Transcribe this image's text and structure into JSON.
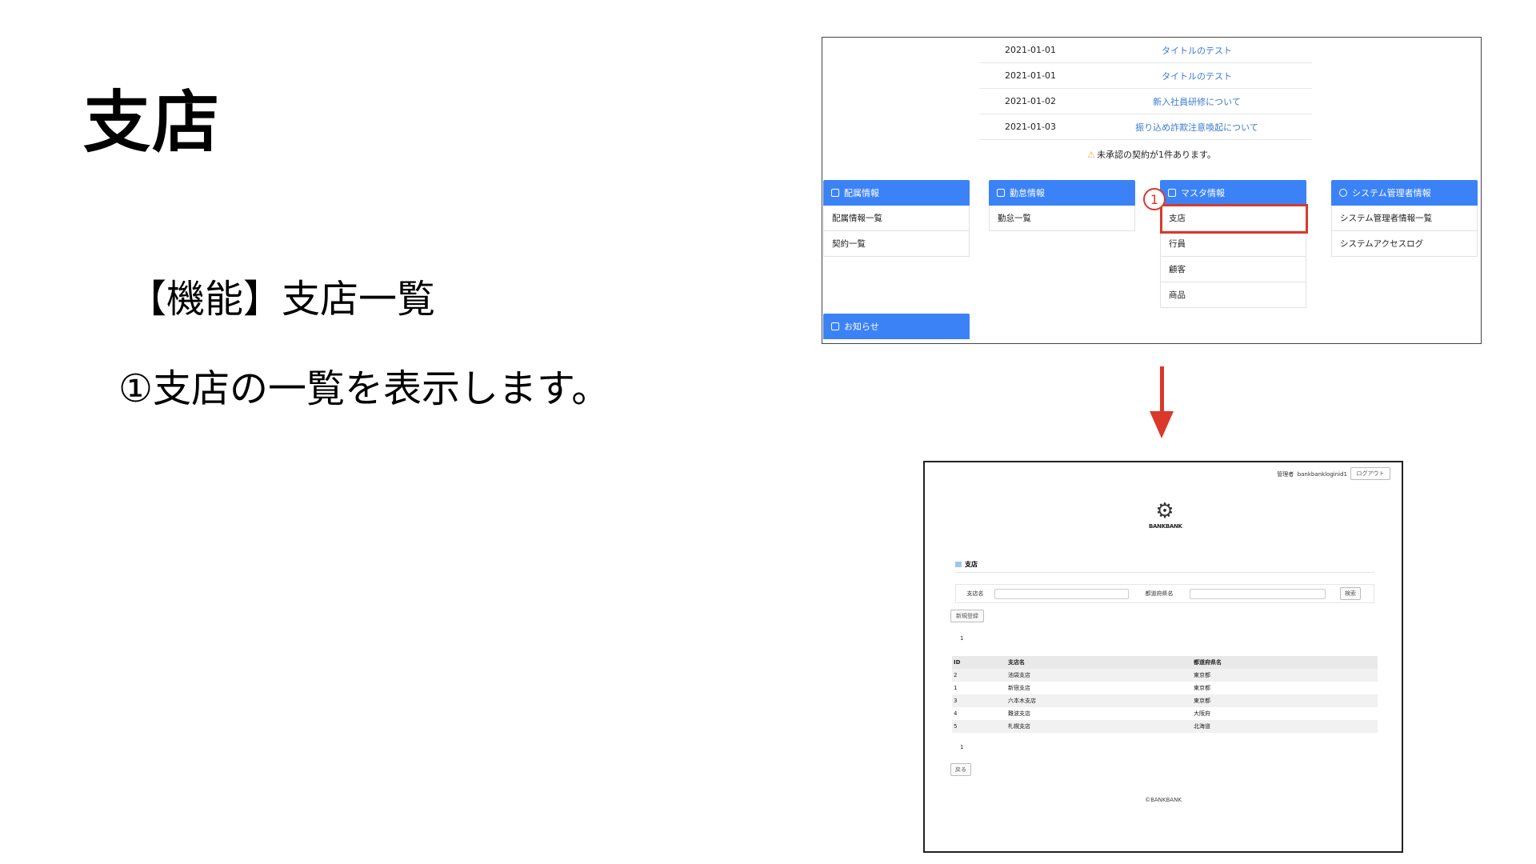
{
  "slide": {
    "title": "支店",
    "feature": "【機能】支店一覧",
    "description": "①支店の一覧を表示します。"
  },
  "top_screen": {
    "news": [
      {
        "date": "2021-01-01",
        "title": "タイトルのテスト"
      },
      {
        "date": "2021-01-01",
        "title": "タイトルのテスト"
      },
      {
        "date": "2021-01-02",
        "title": "新入社員研修について"
      },
      {
        "date": "2021-01-03",
        "title": "振り込め詐欺注意喚起について"
      }
    ],
    "warning_icon": "⚠",
    "warning": "未承認の契約が1件あります。",
    "panels": {
      "placement": {
        "title": "配属情報",
        "items": [
          "配属情報一覧",
          "契約一覧"
        ]
      },
      "attendance": {
        "title": "勤怠情報",
        "items": [
          "勤怠一覧"
        ]
      },
      "master": {
        "title": "マスタ情報",
        "items": [
          "支店",
          "行員",
          "顧客",
          "商品"
        ]
      },
      "sysadmin": {
        "title": "システム管理者情報",
        "items": [
          "システム管理者情報一覧",
          "システムアクセスログ"
        ]
      },
      "notice": {
        "title": "お知らせ"
      }
    },
    "step_number": "1",
    "accent_color": "#3b82f6",
    "highlight_color": "#d9382b"
  },
  "bottom_screen": {
    "user_role": "管理者",
    "user_id": "bankbankloginid1",
    "logout_label": "ログアウト",
    "logo_text": "BANKBANK",
    "section_title": "支店",
    "search": {
      "branch_label": "支店名",
      "pref_label": "都道府県名",
      "search_button": "検索"
    },
    "new_button": "新規登録",
    "page_top": "1",
    "page_bottom": "1",
    "table": {
      "headers": [
        "ID",
        "支店名",
        "都道府県名"
      ],
      "rows": [
        [
          "2",
          "池袋支店",
          "東京都"
        ],
        [
          "1",
          "新宿支店",
          "東京都"
        ],
        [
          "3",
          "六本木支店",
          "東京都"
        ],
        [
          "4",
          "難波支店",
          "大阪府"
        ],
        [
          "5",
          "札幌支店",
          "北海道"
        ]
      ]
    },
    "back_button": "戻る",
    "footer": "©BANKBANK"
  }
}
